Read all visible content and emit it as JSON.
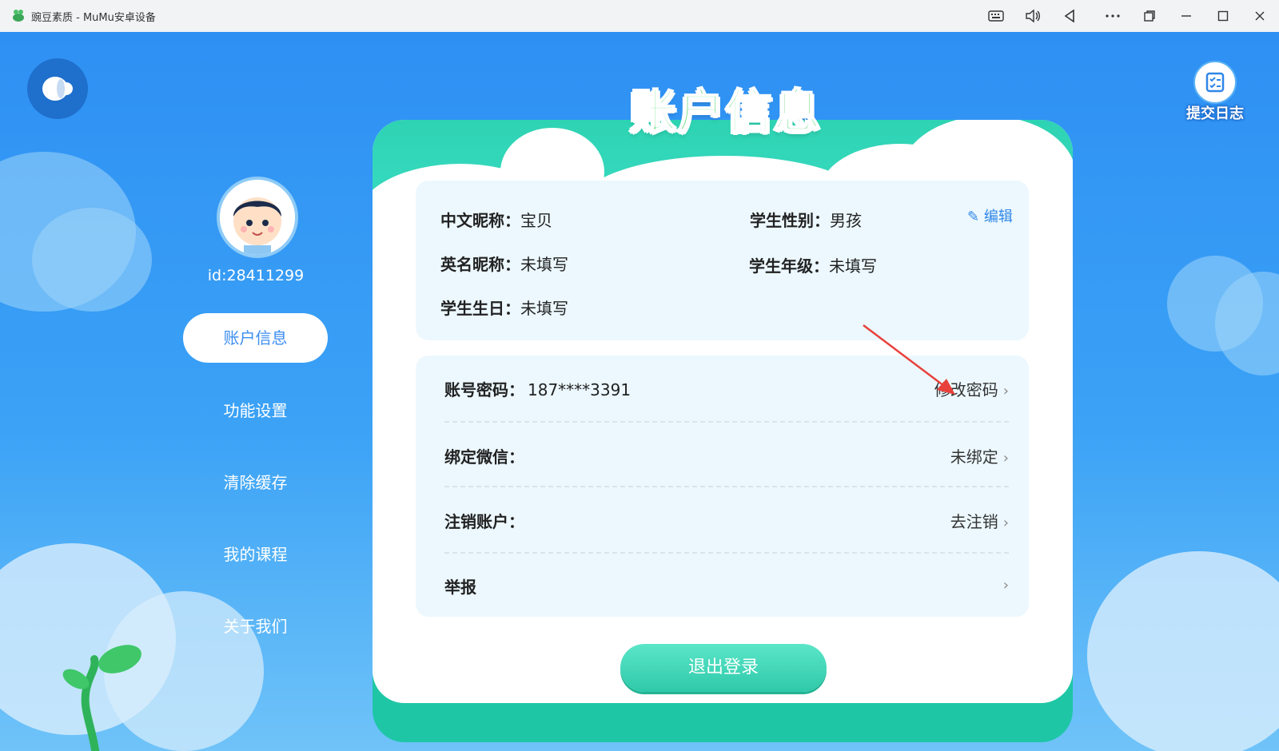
{
  "window": {
    "title": "豌豆素质 - MuMu安卓设备"
  },
  "sidebar": {
    "user_id": "id:28411299",
    "items": [
      {
        "label": "账户信息",
        "active": true
      },
      {
        "label": "功能设置"
      },
      {
        "label": "清除缓存"
      },
      {
        "label": "我的课程"
      },
      {
        "label": "关于我们"
      }
    ]
  },
  "header": {
    "title": "账户信息",
    "log_button": "提交日志"
  },
  "profile": {
    "edit_label": "编辑",
    "fields": [
      {
        "label": "中文昵称：",
        "value": "宝贝"
      },
      {
        "label": "学生性别：",
        "value": "男孩"
      },
      {
        "label": "英名昵称：",
        "value": "未填写"
      },
      {
        "label": "学生年级：",
        "value": "未填写"
      },
      {
        "label": "学生生日：",
        "value": "未填写"
      }
    ]
  },
  "account": {
    "rows": [
      {
        "label": "账号密码：",
        "value": "187****3391",
        "action": "修改密码"
      },
      {
        "label": "绑定微信：",
        "value": "",
        "action": "未绑定"
      },
      {
        "label": "注销账户：",
        "value": "",
        "action": "去注销"
      },
      {
        "label": "举报",
        "value": "",
        "action": ""
      }
    ]
  },
  "logout_label": "退出登录",
  "colors": {
    "accent": "#3d8ef0",
    "header_green": "#2ed3b3",
    "title_green": "#4fd36b",
    "bg_blue": "#2e90f3"
  },
  "icons": [
    "keyboard-icon",
    "volume-icon",
    "back-triangle-icon",
    "more-icon",
    "restore-icon",
    "minimize-icon",
    "maximize-icon",
    "close-icon"
  ]
}
